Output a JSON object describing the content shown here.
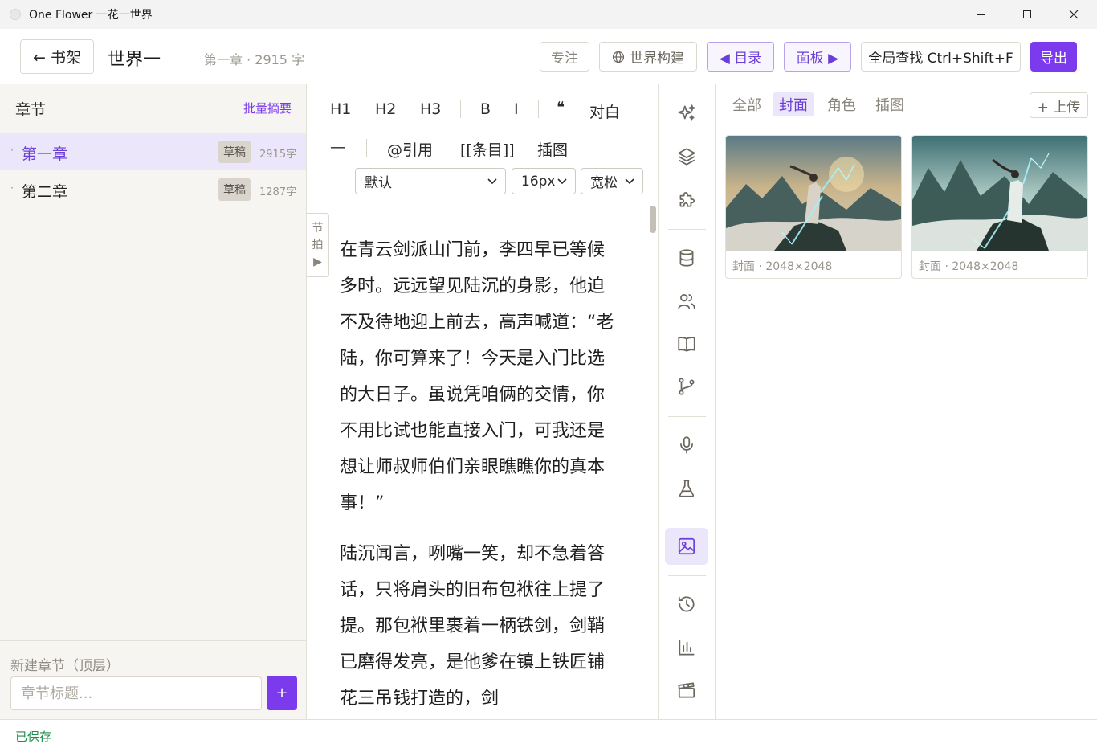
{
  "window": {
    "title": "One Flower 一花一世界"
  },
  "header": {
    "back_label": "← 书架",
    "book_title": "世界一",
    "chapter_meta": "第一章 · 2915 字",
    "focus_label": "专注",
    "world_label": "世界构建",
    "toc_label": "◀ 目录",
    "panel_label": "面板 ▶",
    "search_label": "全局查找 Ctrl+Shift+F",
    "export_label": "导出"
  },
  "sidebar": {
    "title": "章节",
    "batch_label": "批量摘要",
    "chapters": [
      {
        "bullet": "·",
        "name": "第一章",
        "status": "草稿",
        "count": "2915字"
      },
      {
        "bullet": "·",
        "name": "第二章",
        "status": "草稿",
        "count": "1287字"
      }
    ],
    "new_label": "新建章节（顶层）",
    "new_placeholder": "章节标题...",
    "add_label": "+"
  },
  "toolbar": {
    "h1": "H1",
    "h2": "H2",
    "h3": "H3",
    "bold": "B",
    "italic": "I",
    "quote_mark": "❝",
    "dialogue": "对白",
    "dash": "—",
    "mention": "@引用",
    "entry": "[[条目]]",
    "illustration": "插图",
    "font_select": "默认",
    "size_select": "16px",
    "spacing_select": "宽松"
  },
  "beat_tab": {
    "line1": "节",
    "line2": "拍",
    "arrow": "▶"
  },
  "editor": {
    "paragraphs": [
      "在青云剑派山门前，李四早已等候多时。远远望见陆沉的身影，他迫不及待地迎上前去，高声喊道：“老陆，你可算来了！今天是入门比选的大日子。虽说凭咱俩的交情，你不用比试也能直接入门，可我还是想让师叔师伯们亲眼瞧瞧你的真本事！”",
      "陆沉闻言，咧嘴一笑，却不急着答话，只将肩头的旧布包袱往上提了提。那包袱里裹着一柄铁剑，剑鞘已磨得发亮，是他爹在镇上铁匠铺花三吊钱打造的，剑"
    ]
  },
  "rail": {
    "icons": [
      "sparkles-icon",
      "layers-icon",
      "puzzle-icon",
      "database-icon",
      "users-icon",
      "book-icon",
      "branch-icon",
      "mic-icon",
      "flask-icon",
      "image-icon",
      "history-icon",
      "chart-icon",
      "clapper-icon"
    ],
    "active": "image-icon"
  },
  "gallery": {
    "tabs": [
      "全部",
      "封面",
      "角色",
      "插图"
    ],
    "active_tab": "封面",
    "upload_label": "+ 上传",
    "items": [
      {
        "caption": "封面 · 2048×2048"
      },
      {
        "caption": "封面 · 2048×2048"
      }
    ]
  },
  "status": {
    "text": "已保存"
  },
  "colors": {
    "accent": "#7c3aed",
    "saved": "#1f8f4e",
    "accent_soft": "#ece6fb"
  }
}
